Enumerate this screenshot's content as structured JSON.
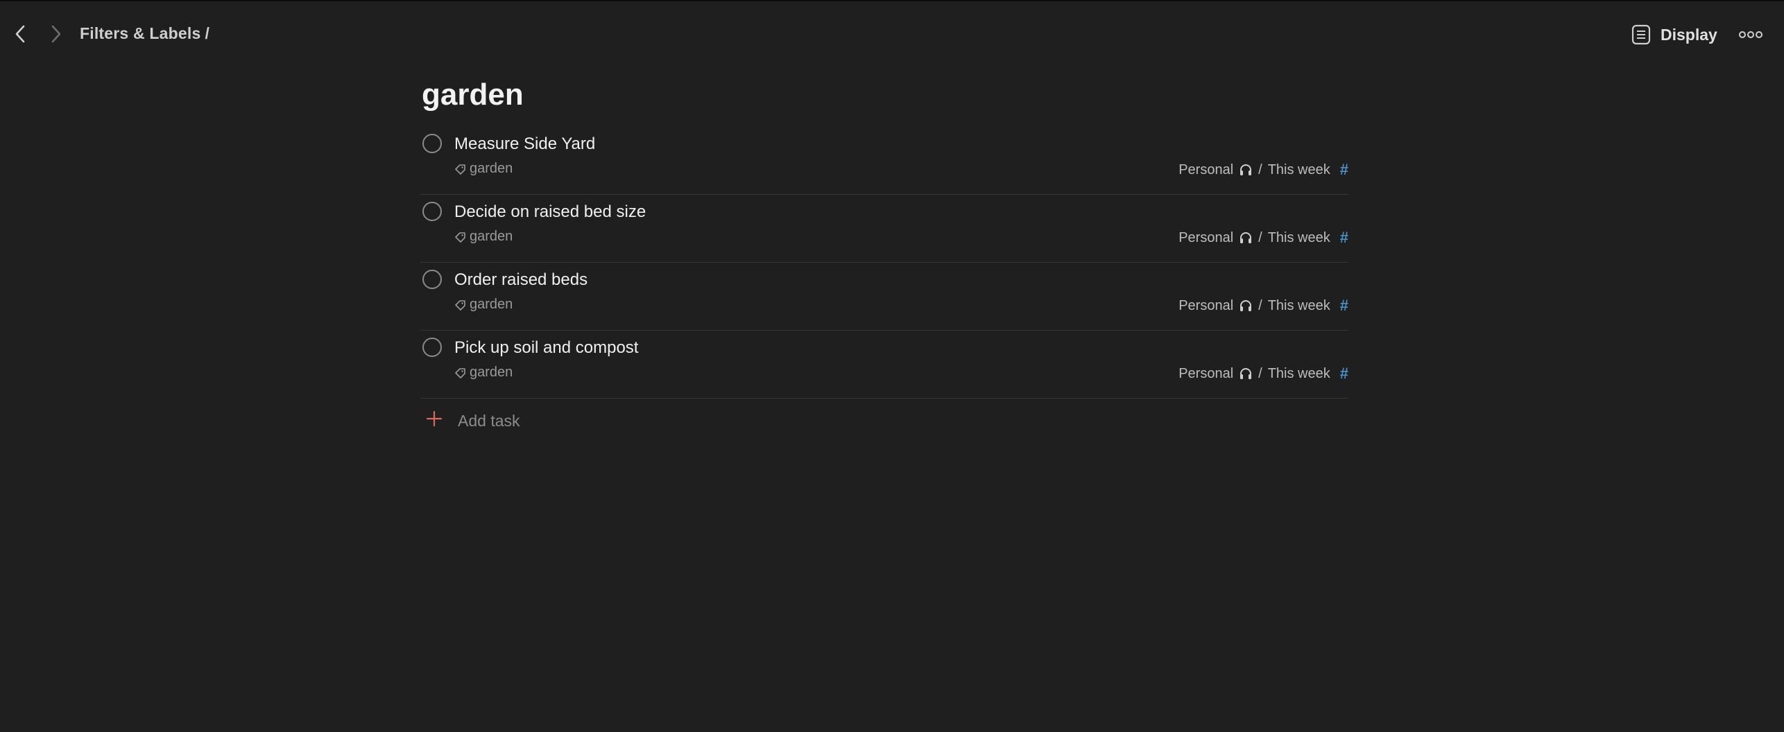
{
  "breadcrumb": {
    "parent": "Filters & Labels",
    "separator": "/"
  },
  "header": {
    "display_label": "Display"
  },
  "page": {
    "title": "garden"
  },
  "tasks": [
    {
      "title": "Measure Side Yard",
      "label": "garden",
      "project": "Personal",
      "section": "This week",
      "separator": "/"
    },
    {
      "title": "Decide on raised bed size",
      "label": "garden",
      "project": "Personal",
      "section": "This week",
      "separator": "/"
    },
    {
      "title": "Order raised beds",
      "label": "garden",
      "project": "Personal",
      "section": "This week",
      "separator": "/"
    },
    {
      "title": "Pick up soil and compost",
      "label": "garden",
      "project": "Personal",
      "section": "This week",
      "separator": "/"
    }
  ],
  "add_task": {
    "label": "Add task"
  },
  "icons": {
    "back": "chevron-left-icon",
    "forward": "chevron-right-icon",
    "display": "list-view-icon",
    "more": "more-horizontal-icon",
    "label": "tag-icon",
    "project_emoji": "headphones-icon",
    "project_hash": "hash-icon",
    "add": "plus-icon"
  },
  "colors": {
    "background": "#1f1f1f",
    "accent_add": "#e0675c",
    "hash": "#4a90c8"
  }
}
